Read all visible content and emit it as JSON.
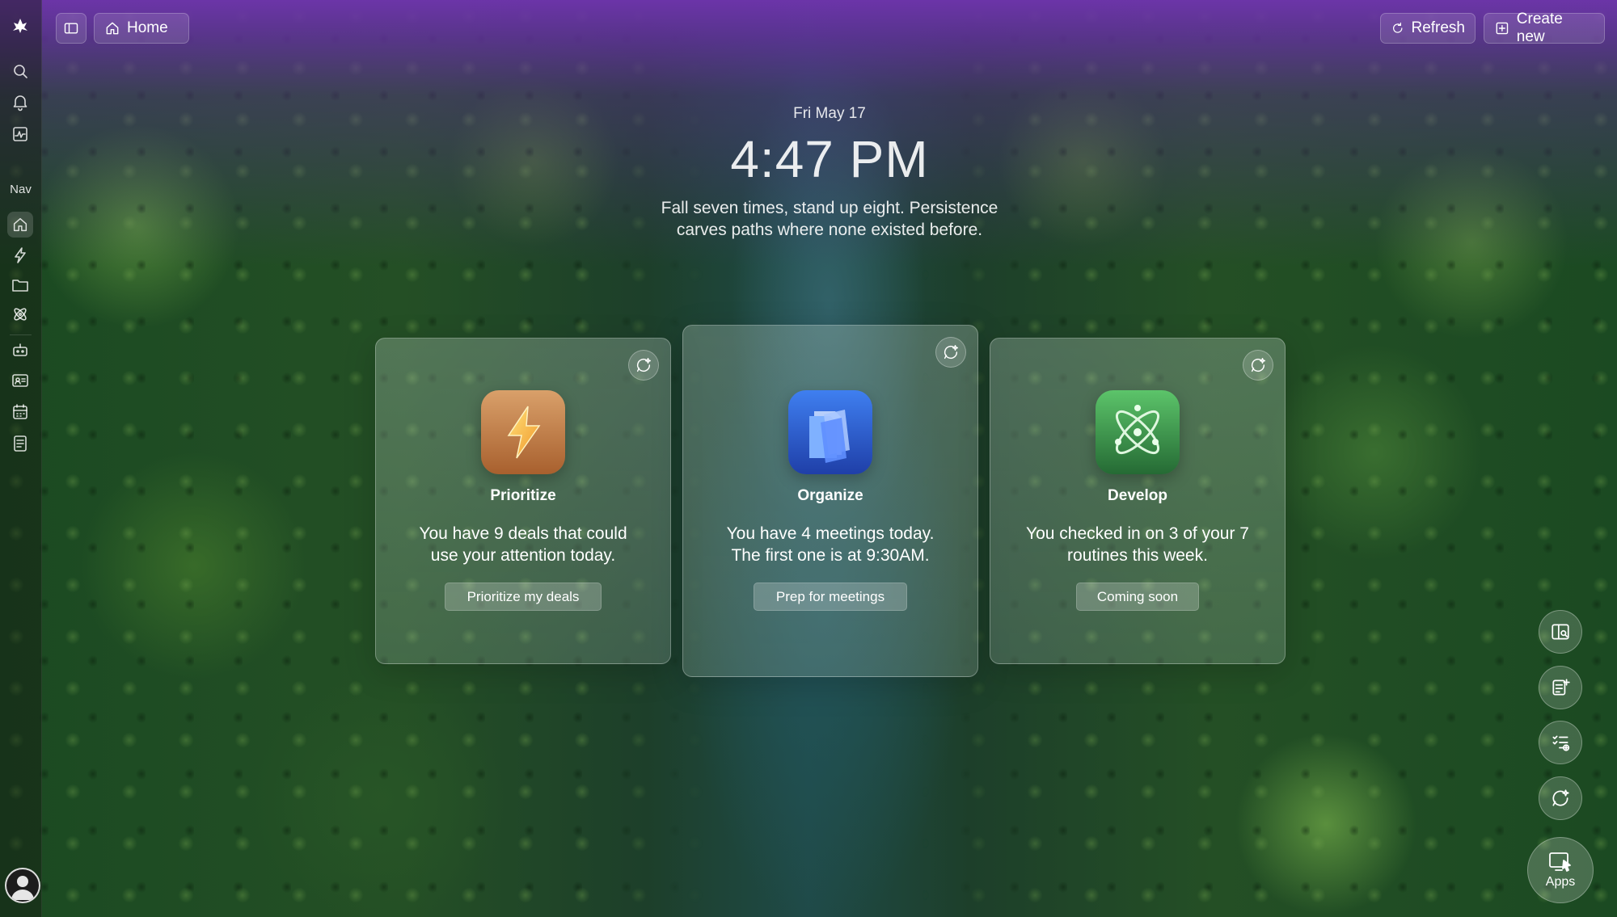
{
  "topbar": {
    "home_label": "Home",
    "refresh_label": "Refresh",
    "create_label": "Create new"
  },
  "sidebar": {
    "nav_label": "Nav",
    "top_icons": [
      "logo-icon",
      "search-icon",
      "bell-icon",
      "activity-icon"
    ],
    "nav_icons": [
      "home-icon",
      "bolt-icon",
      "folder-icon",
      "atom-icon",
      "bot-icon",
      "contact-card-icon",
      "calendar-icon",
      "notes-icon"
    ]
  },
  "header": {
    "date": "Fri May 17",
    "time": "4:47 PM",
    "quote": "Fall seven times, stand up eight. Persistence carves paths where none existed before."
  },
  "cards": [
    {
      "title": "Prioritize",
      "description": "You have 9 deals that could use your attention today.",
      "button": "Prioritize my deals",
      "icon": "lightning-bolt-app-icon",
      "accent": "#c98a4a"
    },
    {
      "title": "Organize",
      "description": "You have 4 meetings today. The first one is at 9:30AM.",
      "button": "Prep for meetings",
      "icon": "folder-app-icon",
      "accent": "#2f5fd0"
    },
    {
      "title": "Develop",
      "description": "You checked in on 3 of your 7 routines this week.",
      "button": "Coming soon",
      "icon": "atom-app-icon",
      "accent": "#3f9a4e"
    }
  ],
  "right_tools": {
    "icons": [
      "layout-search-icon",
      "notes-add-icon",
      "checklist-add-icon",
      "chat-sparkle-icon"
    ],
    "apps_label": "Apps"
  },
  "colors": {
    "header_purple": "#6e34ac",
    "forest_green": "#244f25",
    "river_teal": "#1f4a48"
  }
}
